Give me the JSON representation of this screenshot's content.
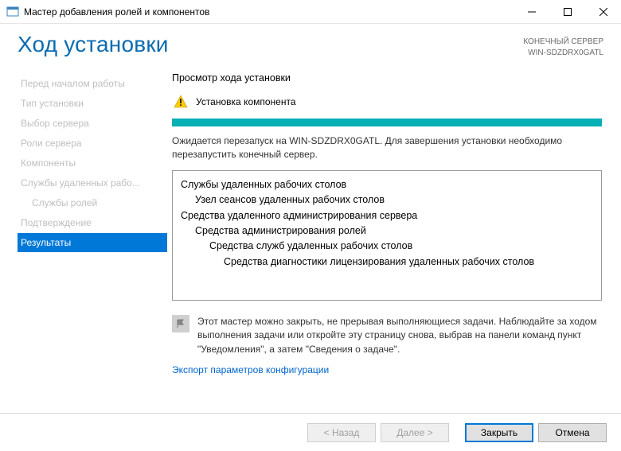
{
  "titlebar": {
    "title": "Мастер добавления ролей и компонентов"
  },
  "header": {
    "page_title": "Ход установки",
    "dest_label": "КОНЕЧНЫЙ СЕРВЕР",
    "dest_value": "WIN-SDZDRX0GATL"
  },
  "nav": {
    "items": [
      {
        "label": "Перед началом работы",
        "active": false,
        "sub": false
      },
      {
        "label": "Тип установки",
        "active": false,
        "sub": false
      },
      {
        "label": "Выбор сервера",
        "active": false,
        "sub": false
      },
      {
        "label": "Роли сервера",
        "active": false,
        "sub": false
      },
      {
        "label": "Компоненты",
        "active": false,
        "sub": false
      },
      {
        "label": "Службы удаленных рабо...",
        "active": false,
        "sub": false
      },
      {
        "label": "Службы ролей",
        "active": false,
        "sub": true
      },
      {
        "label": "Подтверждение",
        "active": false,
        "sub": false
      },
      {
        "label": "Результаты",
        "active": true,
        "sub": false
      }
    ]
  },
  "main": {
    "section_heading": "Просмотр хода установки",
    "status_title": "Установка компонента",
    "progress_pct": 100,
    "status_msg": "Ожидается перезапуск на WIN-SDZDRX0GATL. Для завершения установки необходимо перезапустить конечный сервер.",
    "tree": [
      {
        "level": 0,
        "text": "Службы удаленных рабочих столов"
      },
      {
        "level": 1,
        "text": "Узел сеансов удаленных рабочих столов"
      },
      {
        "level": 0,
        "text": "Средства удаленного администрирования сервера"
      },
      {
        "level": 1,
        "text": "Средства администрирования ролей"
      },
      {
        "level": 2,
        "text": "Средства служб удаленных рабочих столов"
      },
      {
        "level": 3,
        "text": "Средства диагностики лицензирования удаленных рабочих столов"
      }
    ],
    "note": "Этот мастер можно закрыть, не прерывая выполняющиеся задачи. Наблюдайте за ходом выполнения задачи или откройте эту страницу снова, выбрав на панели команд пункт \"Уведомления\", а затем \"Сведения о задаче\".",
    "export_link": "Экспорт параметров конфигурации"
  },
  "footer": {
    "back": "< Назад",
    "next": "Далее >",
    "close": "Закрыть",
    "cancel": "Отмена"
  }
}
